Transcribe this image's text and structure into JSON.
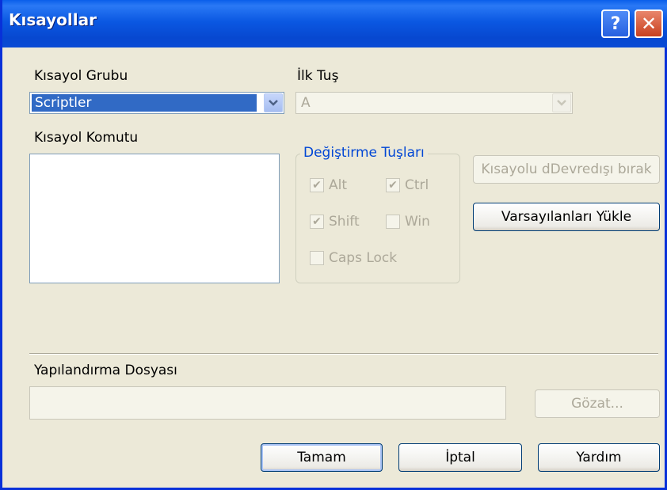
{
  "window": {
    "title": "Kısayollar",
    "help_glyph": "?",
    "close_glyph": "✕"
  },
  "shortcut_group": {
    "label": "Kısayol Grubu",
    "value": "Scriptler"
  },
  "first_key": {
    "label": "İlk Tuş",
    "value": "A"
  },
  "shortcut_command": {
    "label": "Kısayol Komutu"
  },
  "modifiers": {
    "legend": "Değiştirme Tuşları",
    "alt": {
      "label": "Alt",
      "checked": true
    },
    "ctrl": {
      "label": "Ctrl",
      "checked": true
    },
    "shift": {
      "label": "Shift",
      "checked": true
    },
    "win": {
      "label": "Win",
      "checked": false
    },
    "caps_lock": {
      "label": "Caps Lock",
      "checked": false
    }
  },
  "buttons": {
    "disable_shortcut": "Kısayolu dDevredışı bırak",
    "load_defaults": "Varsayılanları Yükle",
    "browse": "Gözat...",
    "ok": "Tamam",
    "cancel": "İptal",
    "help": "Yardım"
  },
  "config_file": {
    "label": "Yapılandırma Dosyası",
    "value": ""
  },
  "colors": {
    "titlebar": "#0A5EEA",
    "dialog_bg": "#ECE9D8",
    "group_legend": "#0046D5",
    "disabled_text": "#ACA899",
    "selection": "#316AC5"
  }
}
